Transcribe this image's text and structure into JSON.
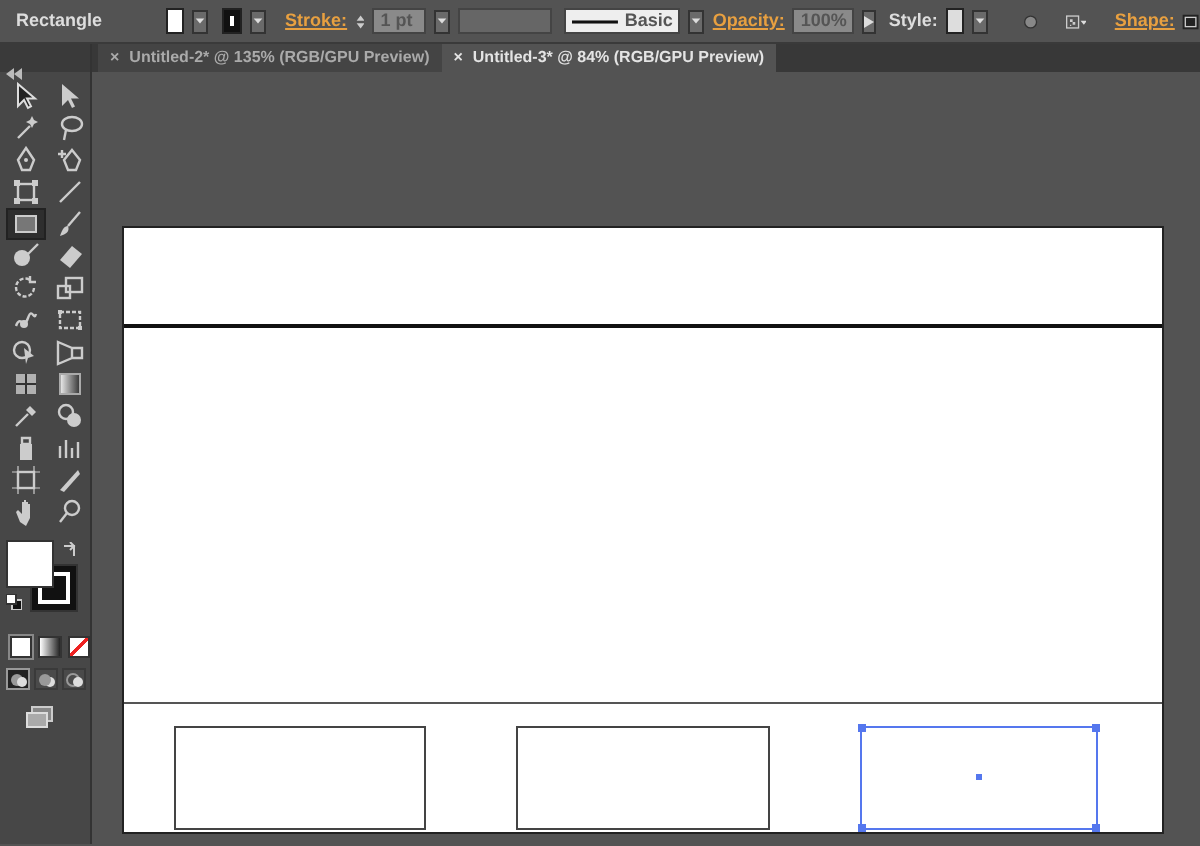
{
  "control_bar": {
    "tool_name": "Rectangle",
    "stroke_label": "Stroke:",
    "stroke_weight": "1 pt",
    "brush_name": "Basic",
    "opacity_label": "Opacity:",
    "opacity": "100%",
    "style_label": "Style:",
    "shape_label": "Shape:"
  },
  "tabs": [
    {
      "close": "×",
      "label": "Untitled-2* @ 135% (RGB/GPU Preview)",
      "selected": false
    },
    {
      "close": "×",
      "label": "Untitled-3* @ 84% (RGB/GPU Preview)",
      "selected": true
    }
  ],
  "tools": [
    {
      "kind": "selection",
      "selected": false
    },
    {
      "kind": "direct-selection",
      "selected": false
    },
    {
      "kind": "magic-wand",
      "selected": false
    },
    {
      "kind": "lasso",
      "selected": false
    },
    {
      "kind": "pen",
      "selected": false
    },
    {
      "kind": "curvature",
      "selected": false
    },
    {
      "kind": "frame",
      "selected": false
    },
    {
      "kind": "line",
      "selected": false
    },
    {
      "kind": "rectangle",
      "selected": true
    },
    {
      "kind": "paintbrush",
      "selected": false
    },
    {
      "kind": "blob-brush",
      "selected": false
    },
    {
      "kind": "eraser",
      "selected": false
    },
    {
      "kind": "rotate",
      "selected": false
    },
    {
      "kind": "scale",
      "selected": false
    },
    {
      "kind": "warp",
      "selected": false
    },
    {
      "kind": "free-transform",
      "selected": false
    },
    {
      "kind": "shape-builder",
      "selected": false
    },
    {
      "kind": "perspective",
      "selected": false
    },
    {
      "kind": "mesh",
      "selected": false
    },
    {
      "kind": "gradient",
      "selected": false
    },
    {
      "kind": "eyedropper",
      "selected": false
    },
    {
      "kind": "blend",
      "selected": false
    },
    {
      "kind": "symbol-sprayer",
      "selected": false
    },
    {
      "kind": "graph",
      "selected": false
    },
    {
      "kind": "artboard",
      "selected": false
    },
    {
      "kind": "slice",
      "selected": false
    },
    {
      "kind": "hand",
      "selected": false
    },
    {
      "kind": "zoom",
      "selected": false
    }
  ],
  "color_modes": [
    {
      "kind": "color",
      "selected": true
    },
    {
      "kind": "gradient",
      "selected": false
    },
    {
      "kind": "none",
      "selected": false
    }
  ],
  "draw_modes": [
    {
      "kind": "normal",
      "selected": true
    },
    {
      "kind": "behind",
      "selected": false
    },
    {
      "kind": "inside",
      "selected": false
    }
  ],
  "artboard": {
    "shapes": [
      {
        "kind": "rectangle",
        "selected": false
      },
      {
        "kind": "rectangle",
        "selected": false
      },
      {
        "kind": "rectangle",
        "selected": true
      }
    ]
  }
}
